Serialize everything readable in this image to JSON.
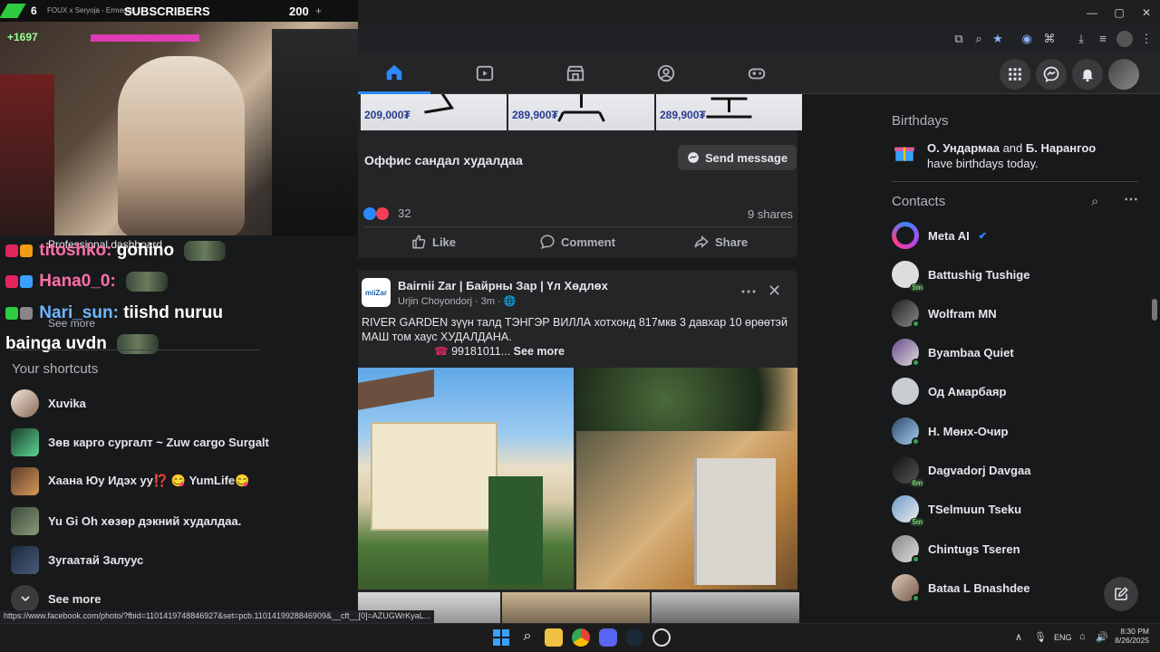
{
  "stream": {
    "sub_count_left": "6",
    "tab_title": "FOUX x Seryoja - Ermegtei...",
    "subscribers_label": "SUBSCRIBERS",
    "sub_goal": "200",
    "plus": "+",
    "cam_overlay_number": "+1697"
  },
  "chat": {
    "lines": [
      {
        "name": "titoshko:",
        "message": "gohino"
      },
      {
        "name": "Hana0_0:",
        "message": ""
      },
      {
        "name": "Nari_sun:",
        "message": "tiishd nuruu"
      },
      {
        "name": "",
        "message": "bainga uvdn"
      }
    ]
  },
  "left_menu": {
    "professional_dashboard": "Professional dashboard",
    "see_more_top": "See more",
    "shortcuts_title": "Your shortcuts",
    "shortcuts": [
      {
        "label": "Xuvika"
      },
      {
        "label": "Зөв карго сургалт ~ Zuw cargo Surgalt"
      },
      {
        "label": "Хаана Юу Идэх уу⁉️ 😋 YumLife😋"
      },
      {
        "label": "Yu Gi Oh хөзөр дэкний худалдаа."
      },
      {
        "label": "Зугаатай Залуус"
      }
    ],
    "see_more_bottom": "See more"
  },
  "post1": {
    "prices": [
      "209,000₮",
      "289,900₮",
      "289,900₮"
    ],
    "title": "Оффис сандал худалдаа",
    "send_message": "Send message",
    "reactions_count": "32",
    "shares": "9 shares",
    "like": "Like",
    "comment": "Comment",
    "share": "Share"
  },
  "post2": {
    "page_name": "Bairnii Zar | Байрны Зар | Үл Хөдлөх",
    "author": "Urjin Choyondorj",
    "time": "3m",
    "text_line1": "RIVER GARDEN зүүн талд ТЭНГЭР ВИЛЛА хотхонд 817мкв 3 давхар 10 өрөөтэй",
    "text_line2": "МАШ том хаус ХУДАЛДАНА.",
    "phone_snippet": "99181011...",
    "see_more": "See more",
    "avatar_label": "miiZar"
  },
  "birthdays": {
    "title": "Birthdays",
    "name1": "О. Ундармаа",
    "and": "and",
    "name2": "Б. Нарангоо",
    "tail": "have birthdays today."
  },
  "contacts": {
    "title": "Contacts",
    "list": [
      {
        "name": "Meta AI",
        "status": ""
      },
      {
        "name": "Battushig Tushige",
        "status": "5m"
      },
      {
        "name": "Wolfram MN",
        "status": "online"
      },
      {
        "name": "Byambaa Quiet",
        "status": "online"
      },
      {
        "name": "Од Амарбаяр",
        "status": ""
      },
      {
        "name": "Н. Мөнх-Очир",
        "status": "online"
      },
      {
        "name": "Dagvadorj Davgaa",
        "status": "6m"
      },
      {
        "name": "TSelmuun Tseku",
        "status": "5m"
      },
      {
        "name": "Chintugs Tseren",
        "status": "online"
      },
      {
        "name": "Bataa L Bnashdee",
        "status": "online"
      }
    ]
  },
  "status_url": "https://www.facebook.com/photo/?fbid=1101419748846927&set=pcb.1101419928846909&__cft__[0]=AZUGWrKyaL...",
  "taskbar": {
    "lang": "ENG",
    "time": "8:30 PM",
    "date": "8/26/2025"
  },
  "colors": {
    "fb_blue": "#2d88ff",
    "card_bg": "#242526",
    "page_bg": "#18191a",
    "online_green": "#31a24c"
  }
}
